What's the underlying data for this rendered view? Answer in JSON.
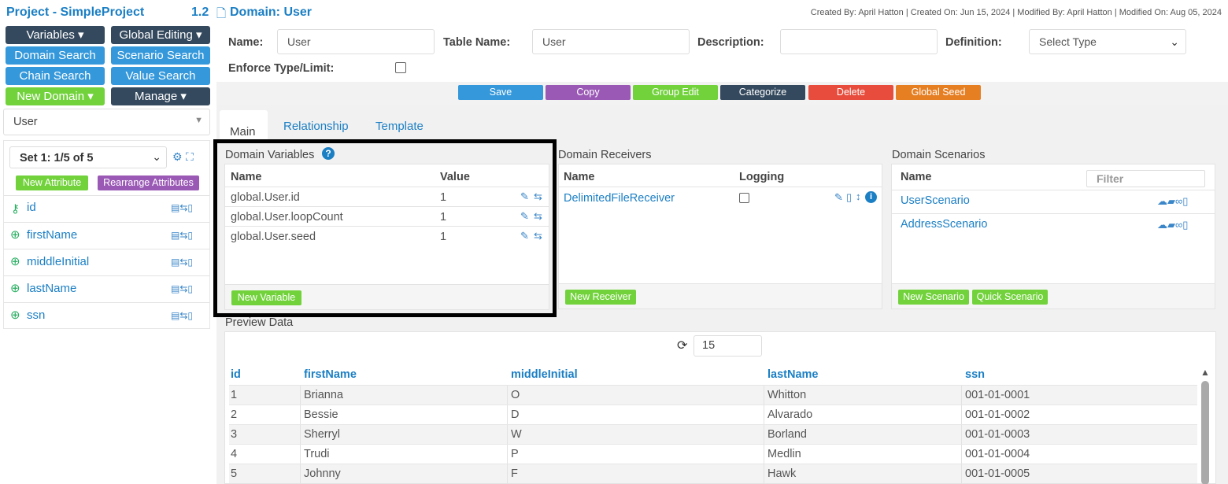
{
  "sidebar": {
    "project_title": "Project - SimpleProject",
    "version": "1.2",
    "buttons": {
      "variables": "Variables",
      "global_editing": "Global Editing",
      "domain_search": "Domain Search",
      "scenario_search": "Scenario Search",
      "chain_search": "Chain Search",
      "value_search": "Value Search",
      "new_domain": "New Domain",
      "manage": "Manage"
    },
    "domain_select": "User",
    "set_select": "Set 1: 1/5 of 5",
    "new_attribute": "New Attribute",
    "rearrange_attributes": "Rearrange Attributes",
    "attributes": [
      {
        "name": "id",
        "icon": "key-icon"
      },
      {
        "name": "firstName",
        "icon": "lifebuoy-icon"
      },
      {
        "name": "middleInitial",
        "icon": "lifebuoy-icon"
      },
      {
        "name": "lastName",
        "icon": "lifebuoy-icon"
      },
      {
        "name": "ssn",
        "icon": "lifebuoy-icon"
      }
    ]
  },
  "header": {
    "domain_title": "Domain: User",
    "meta": "Created By: April Hatton | Created On: Jun 15, 2024 | Modified By: April Hatton | Modified On: Aug 05, 2024"
  },
  "form": {
    "name_label": "Name:",
    "name_value": "User",
    "table_name_label": "Table Name:",
    "table_name_value": "User",
    "description_label": "Description:",
    "description_value": "",
    "definition_label": "Definition:",
    "definition_value": "Select Type",
    "enforce_label": "Enforce Type/Limit:"
  },
  "actions": {
    "save": "Save",
    "copy": "Copy",
    "group_edit": "Group Edit",
    "categorize": "Categorize",
    "delete": "Delete",
    "global_seed": "Global Seed"
  },
  "tabs": {
    "main": "Main",
    "relationship": "Relationship",
    "template": "Template"
  },
  "variables_panel": {
    "title": "Domain Variables",
    "col_name": "Name",
    "col_value": "Value",
    "rows": [
      {
        "name": "global.User.id",
        "value": "1"
      },
      {
        "name": "global.User.loopCount",
        "value": "1"
      },
      {
        "name": "global.User.seed",
        "value": "1"
      }
    ],
    "new_button": "New Variable"
  },
  "receivers_panel": {
    "title": "Domain Receivers",
    "col_name": "Name",
    "col_logging": "Logging",
    "rows": [
      {
        "name": "DelimitedFileReceiver"
      }
    ],
    "new_button": "New Receiver"
  },
  "scenarios_panel": {
    "title": "Domain Scenarios",
    "col_name": "Name",
    "filter_placeholder": "Filter",
    "rows": [
      {
        "name": "UserScenario"
      },
      {
        "name": "AddressScenario"
      }
    ],
    "new_button": "New Scenario",
    "quick_button": "Quick Scenario"
  },
  "preview": {
    "title": "Preview Data",
    "count": "15",
    "columns": [
      "id",
      "firstName",
      "middleInitial",
      "lastName",
      "ssn"
    ],
    "rows": [
      [
        "1",
        "Brianna",
        "O",
        "Whitton",
        "001-01-0001"
      ],
      [
        "2",
        "Bessie",
        "D",
        "Alvarado",
        "001-01-0002"
      ],
      [
        "3",
        "Sherryl",
        "W",
        "Borland",
        "001-01-0003"
      ],
      [
        "4",
        "Trudi",
        "P",
        "Medlin",
        "001-01-0004"
      ],
      [
        "5",
        "Johnny",
        "F",
        "Hawk",
        "001-01-0005"
      ]
    ]
  },
  "colors": {
    "dark": "#34495e",
    "blue": "#3498db",
    "green": "#72d23c",
    "purple": "#9b59b6",
    "red": "#e74c3c",
    "orange": "#e67e22",
    "link": "#1b7fc4"
  }
}
